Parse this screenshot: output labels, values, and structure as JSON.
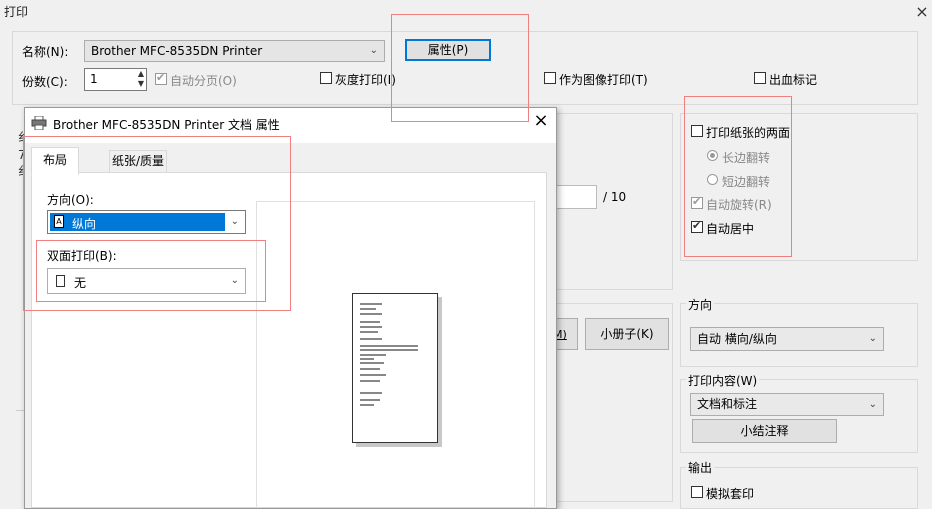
{
  "window": {
    "title": "打印",
    "close": "×"
  },
  "printer": {
    "name_label": "名称(N):",
    "name_value": "Brother MFC-8535DN Printer",
    "properties_button": "属性(P)",
    "copies_label": "份数(C):",
    "copies_value": "1",
    "collate_label": "自动分页(O)",
    "grayscale_label": "灰度打印(I)",
    "print_as_image_label": "作为图像打印(T)",
    "bleed_marks_label": "出血标记"
  },
  "page_range": {
    "page_total": "/ 10",
    "booklet_button": "小册子(K)",
    "partial_button_text": "M)"
  },
  "duplex_panel": {
    "both_sides_label": "打印纸张的两面",
    "flip_long_label": "长边翻转",
    "flip_short_label": "短边翻转",
    "auto_rotate_label": "自动旋转(R)",
    "auto_center_label": "自动居中"
  },
  "orientation_panel": {
    "header": "方向",
    "value": "自动 横向/纵向"
  },
  "print_content": {
    "header": "打印内容(W)",
    "value": "文档和标注",
    "summarize_button": "小结注释"
  },
  "output": {
    "header": "输出",
    "simulate_overprint_label": "模拟套印"
  },
  "properties_dialog": {
    "title": "Brother MFC-8535DN Printer 文档 属性",
    "close": "×",
    "tabs": [
      "布局",
      "纸张/质量"
    ],
    "orientation_label": "方向(O):",
    "orientation_value": "纵向",
    "duplex_label": "双面打印(B):",
    "duplex_value": "无"
  },
  "left_clip_chars": [
    "纟",
    "7",
    "纟"
  ],
  "colors": {
    "highlight_box": "#f08080",
    "selection": "#0078d7"
  },
  "icons": [
    "printer-icon",
    "portrait-page-icon",
    "page-icon",
    "chevron-down-icon",
    "spin-up-icon",
    "spin-down-icon",
    "close-icon"
  ]
}
